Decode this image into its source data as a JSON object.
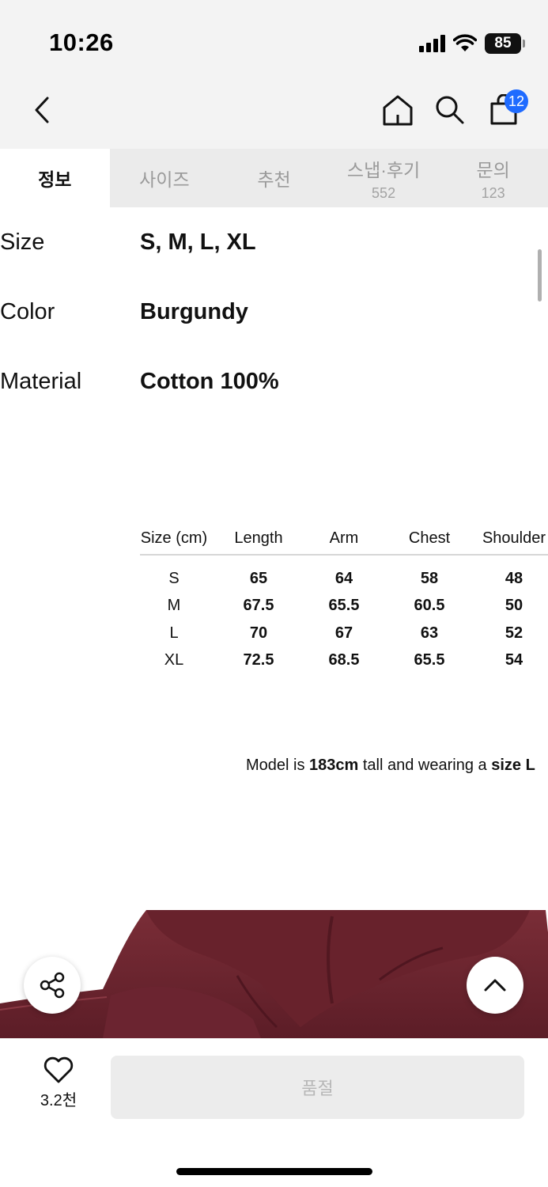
{
  "status": {
    "time": "10:26",
    "battery": "85"
  },
  "nav": {
    "cart_count": "12"
  },
  "tabs": [
    {
      "label": "정보",
      "count": ""
    },
    {
      "label": "사이즈",
      "count": ""
    },
    {
      "label": "추천",
      "count": ""
    },
    {
      "label": "스냅·후기",
      "count": "552"
    },
    {
      "label": "문의",
      "count": "123"
    }
  ],
  "info": [
    {
      "key": "Size",
      "value": "S, M, L, XL"
    },
    {
      "key": "Color",
      "value": "Burgundy"
    },
    {
      "key": "Material",
      "value": "Cotton 100%"
    }
  ],
  "size_table": {
    "headers": [
      "Size (cm)",
      "Length",
      "Arm",
      "Chest",
      "Shoulder"
    ],
    "rows": [
      [
        "S",
        "65",
        "64",
        "58",
        "48"
      ],
      [
        "M",
        "67.5",
        "65.5",
        "60.5",
        "50"
      ],
      [
        "L",
        "70",
        "67",
        "63",
        "52"
      ],
      [
        "XL",
        "72.5",
        "68.5",
        "65.5",
        "54"
      ]
    ]
  },
  "model_note": {
    "part1": "Model is ",
    "height": "183cm",
    "part2": " tall and wearing a ",
    "size": "size L"
  },
  "bottom": {
    "likes": "3.2천",
    "soldout_label": "품절"
  },
  "colors": {
    "accent": "#1f6bff",
    "product": "#6e2630"
  }
}
